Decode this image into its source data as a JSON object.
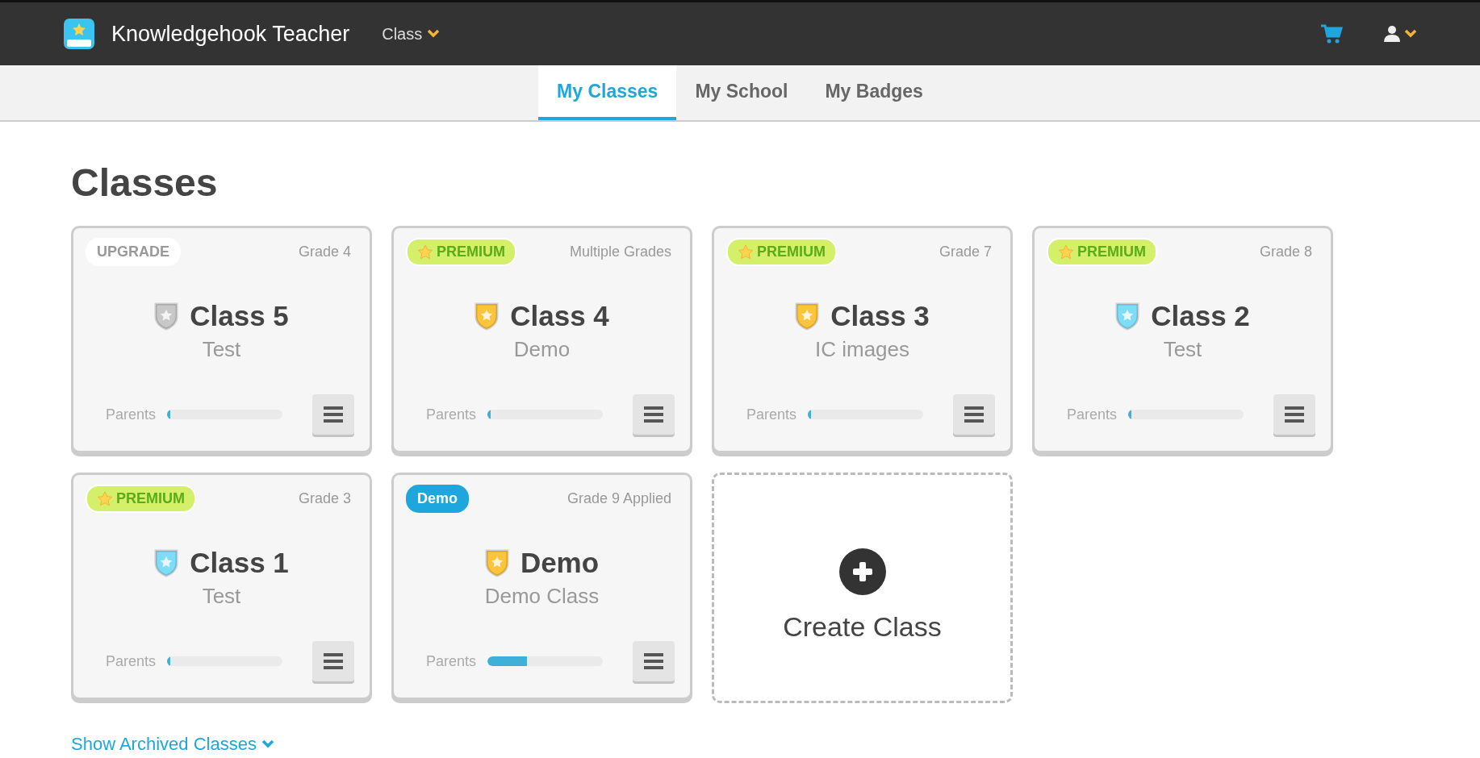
{
  "header": {
    "app_name": "Knowledgehook Teacher",
    "class_menu": "Class"
  },
  "tabs": [
    {
      "label": "My Classes",
      "selected": true
    },
    {
      "label": "My School",
      "selected": false
    },
    {
      "label": "My Badges",
      "selected": false
    }
  ],
  "page_title": "Classes",
  "classes": [
    {
      "badge": {
        "kind": "upgrade",
        "label": "UPGRADE"
      },
      "grade": "Grade 4",
      "color": "#c8c8c8",
      "name": "Class 5",
      "subtitle": "Test",
      "parents_label": "Parents",
      "level": 0.03
    },
    {
      "badge": {
        "kind": "premium",
        "label": "PREMIUM"
      },
      "grade": "Multiple Grades",
      "color": "#fcc43a",
      "name": "Class 4",
      "subtitle": "Demo",
      "parents_label": "Parents",
      "level": 0.03
    },
    {
      "badge": {
        "kind": "premium",
        "label": "PREMIUM"
      },
      "grade": "Grade 7",
      "color": "#fcc43a",
      "name": "Class 3",
      "subtitle": "IC images",
      "parents_label": "Parents",
      "level": 0.03
    },
    {
      "badge": {
        "kind": "premium",
        "label": "PREMIUM"
      },
      "grade": "Grade 8",
      "color": "#7fdcf7",
      "name": "Class 2",
      "subtitle": "Test",
      "parents_label": "Parents",
      "level": 0.03
    },
    {
      "badge": {
        "kind": "premium",
        "label": "PREMIUM"
      },
      "grade": "Grade 3",
      "color": "#7fdcf7",
      "name": "Class 1",
      "subtitle": "Test",
      "parents_label": "Parents",
      "level": 0.03
    },
    {
      "badge": {
        "kind": "demo",
        "label": "Demo"
      },
      "grade": "Grade 9 Applied",
      "color": "#fcc43a",
      "name": "Demo",
      "subtitle": "Demo Class",
      "parents_label": "Parents",
      "level": 0.34
    }
  ],
  "create_card": {
    "label": "Create Class"
  },
  "archived_link": "Show Archived Classes"
}
